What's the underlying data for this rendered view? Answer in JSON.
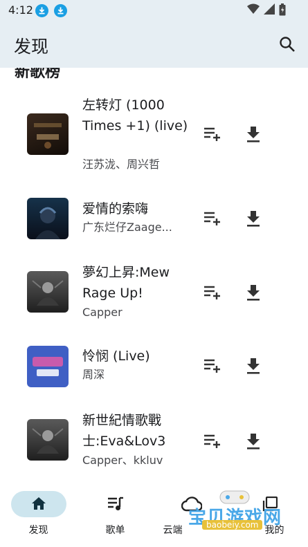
{
  "status_bar": {
    "time": "4:12"
  },
  "app_bar": {
    "title": "发现"
  },
  "section": {
    "title": "新歌榜"
  },
  "songs": [
    {
      "title": "左转灯 (1000 Times +1) (live)",
      "artist": "汪苏泷、周兴哲"
    },
    {
      "title": "爱情的索嗨",
      "artist": "广东烂仔Zaage..."
    },
    {
      "title": "夢幻上昇:Mew Rage Up!",
      "artist": "Capper"
    },
    {
      "title": "怜悯 (Live)",
      "artist": "周深"
    },
    {
      "title": "新世紀情歌戰士:Eva&Lov3",
      "artist": "Capper、kkluv"
    }
  ],
  "nav": {
    "items": [
      {
        "label": "发现",
        "icon": "home-icon",
        "selected": true
      },
      {
        "label": "歌单",
        "icon": "playlist-icon",
        "selected": false
      },
      {
        "label": "云端",
        "icon": "cloud-icon",
        "selected": false
      },
      {
        "label": "我的",
        "icon": "library-icon",
        "selected": false
      }
    ]
  },
  "watermark": {
    "text": "宝贝游戏网",
    "url": "baobeiy.com"
  },
  "colors": {
    "bar_bg": "#e6eef3",
    "nav_selected": "#cde5ee",
    "accent": "#1a9fe3"
  }
}
